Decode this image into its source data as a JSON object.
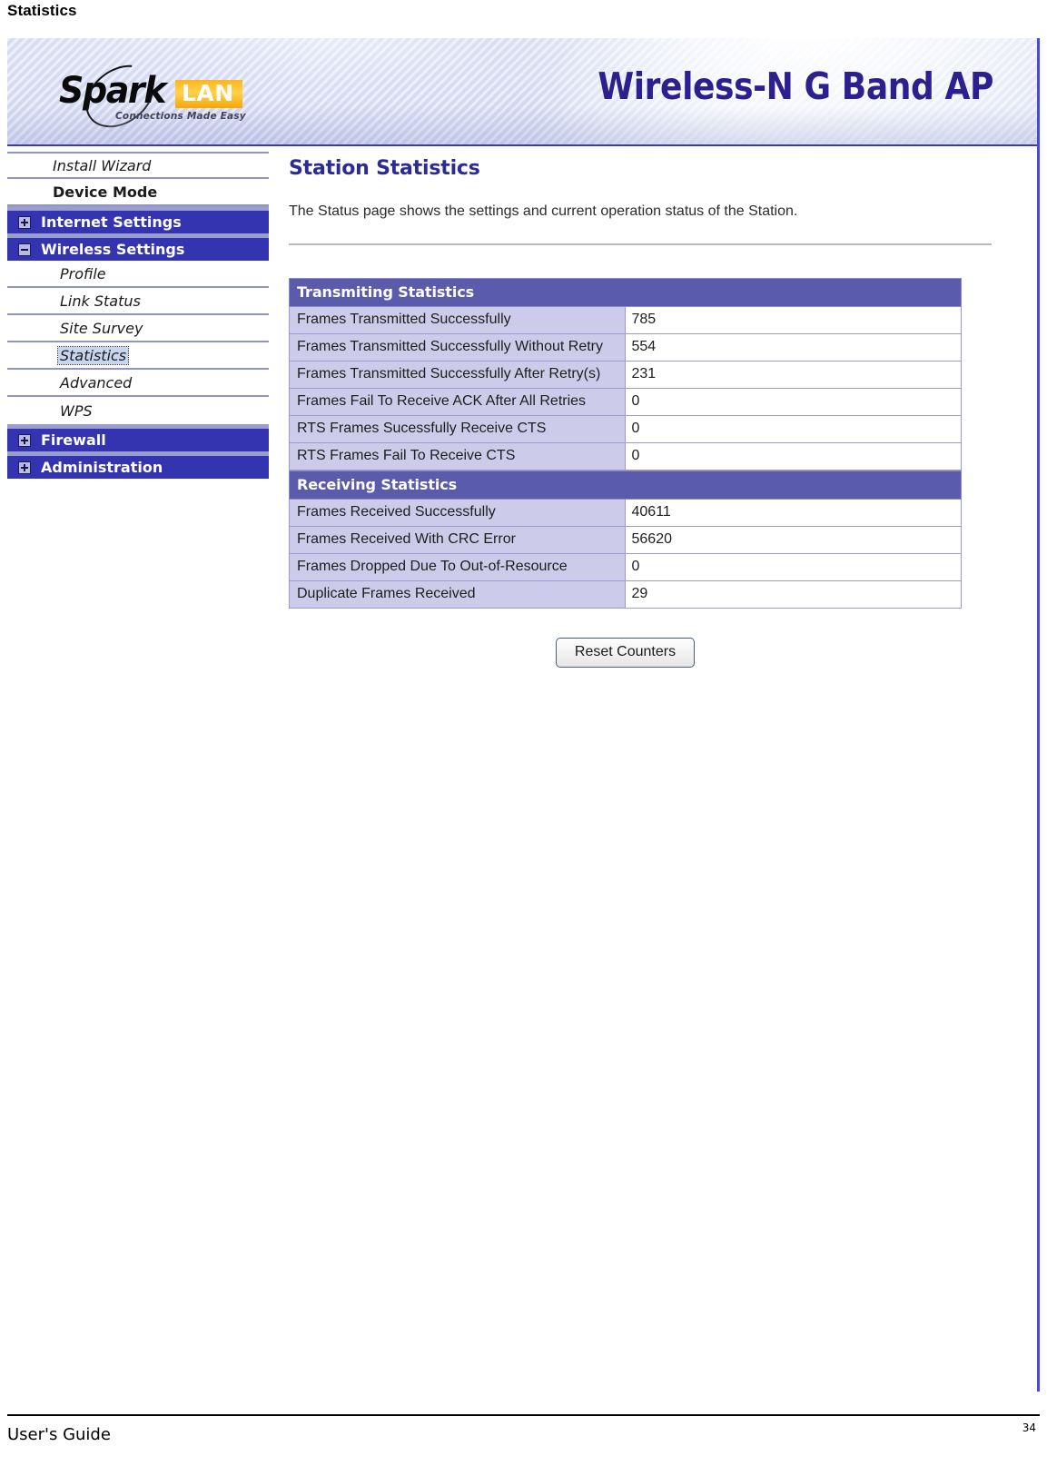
{
  "document": {
    "heading": "Statistics",
    "footer_left": "User's Guide",
    "footer_page": "34"
  },
  "banner": {
    "logo_main": "Spark",
    "logo_badge": "LAN",
    "logo_tagline": "Connections Made Easy",
    "product_title": "Wireless-N G Band AP",
    "accent_color": "#2c2090",
    "badge_color": "#ffb41c"
  },
  "sidebar": {
    "top_items": [
      {
        "label": "Install Wizard",
        "style": "italic"
      },
      {
        "label": "Device Mode",
        "style": "bold"
      }
    ],
    "sections": [
      {
        "label": "Internet Settings",
        "toggle": "plus-icon",
        "expanded": false
      },
      {
        "label": "Wireless Settings",
        "toggle": "minus-icon",
        "expanded": true
      },
      {
        "label": "Firewall",
        "toggle": "plus-icon",
        "expanded": false
      },
      {
        "label": "Administration",
        "toggle": "plus-icon",
        "expanded": false
      }
    ],
    "wireless_items": [
      {
        "label": "Profile",
        "active": false
      },
      {
        "label": "Link Status",
        "active": false
      },
      {
        "label": "Site Survey",
        "active": false
      },
      {
        "label": "Statistics",
        "active": true
      },
      {
        "label": "Advanced",
        "active": false
      },
      {
        "label": "WPS",
        "active": false
      }
    ],
    "section_color": "#3434b0",
    "active_item_color": "#c7d6ef"
  },
  "main": {
    "title": "Station Statistics",
    "description": "The Status page shows the settings and current operation status of the Station.",
    "reset_button": "Reset Counters",
    "table": {
      "header_color": "#5b5bab",
      "label_cell_color": "#ccccea",
      "groups": [
        {
          "title": "Transmiting Statistics",
          "rows": [
            {
              "label": "Frames Transmitted Successfully",
              "value": "785"
            },
            {
              "label": "Frames Transmitted Successfully Without Retry",
              "value": "554"
            },
            {
              "label": "Frames Transmitted Successfully After Retry(s)",
              "value": "231"
            },
            {
              "label": "Frames Fail To Receive ACK After All Retries",
              "value": "0"
            },
            {
              "label": "RTS Frames Sucessfully Receive CTS",
              "value": "0"
            },
            {
              "label": "RTS Frames Fail To Receive CTS",
              "value": "0"
            }
          ]
        },
        {
          "title": "Receiving Statistics",
          "rows": [
            {
              "label": "Frames Received Successfully",
              "value": "40611"
            },
            {
              "label": "Frames Received With CRC Error",
              "value": "56620"
            },
            {
              "label": "Frames Dropped Due To Out-of-Resource",
              "value": "0"
            },
            {
              "label": "Duplicate Frames Received",
              "value": "29"
            }
          ]
        }
      ]
    }
  }
}
